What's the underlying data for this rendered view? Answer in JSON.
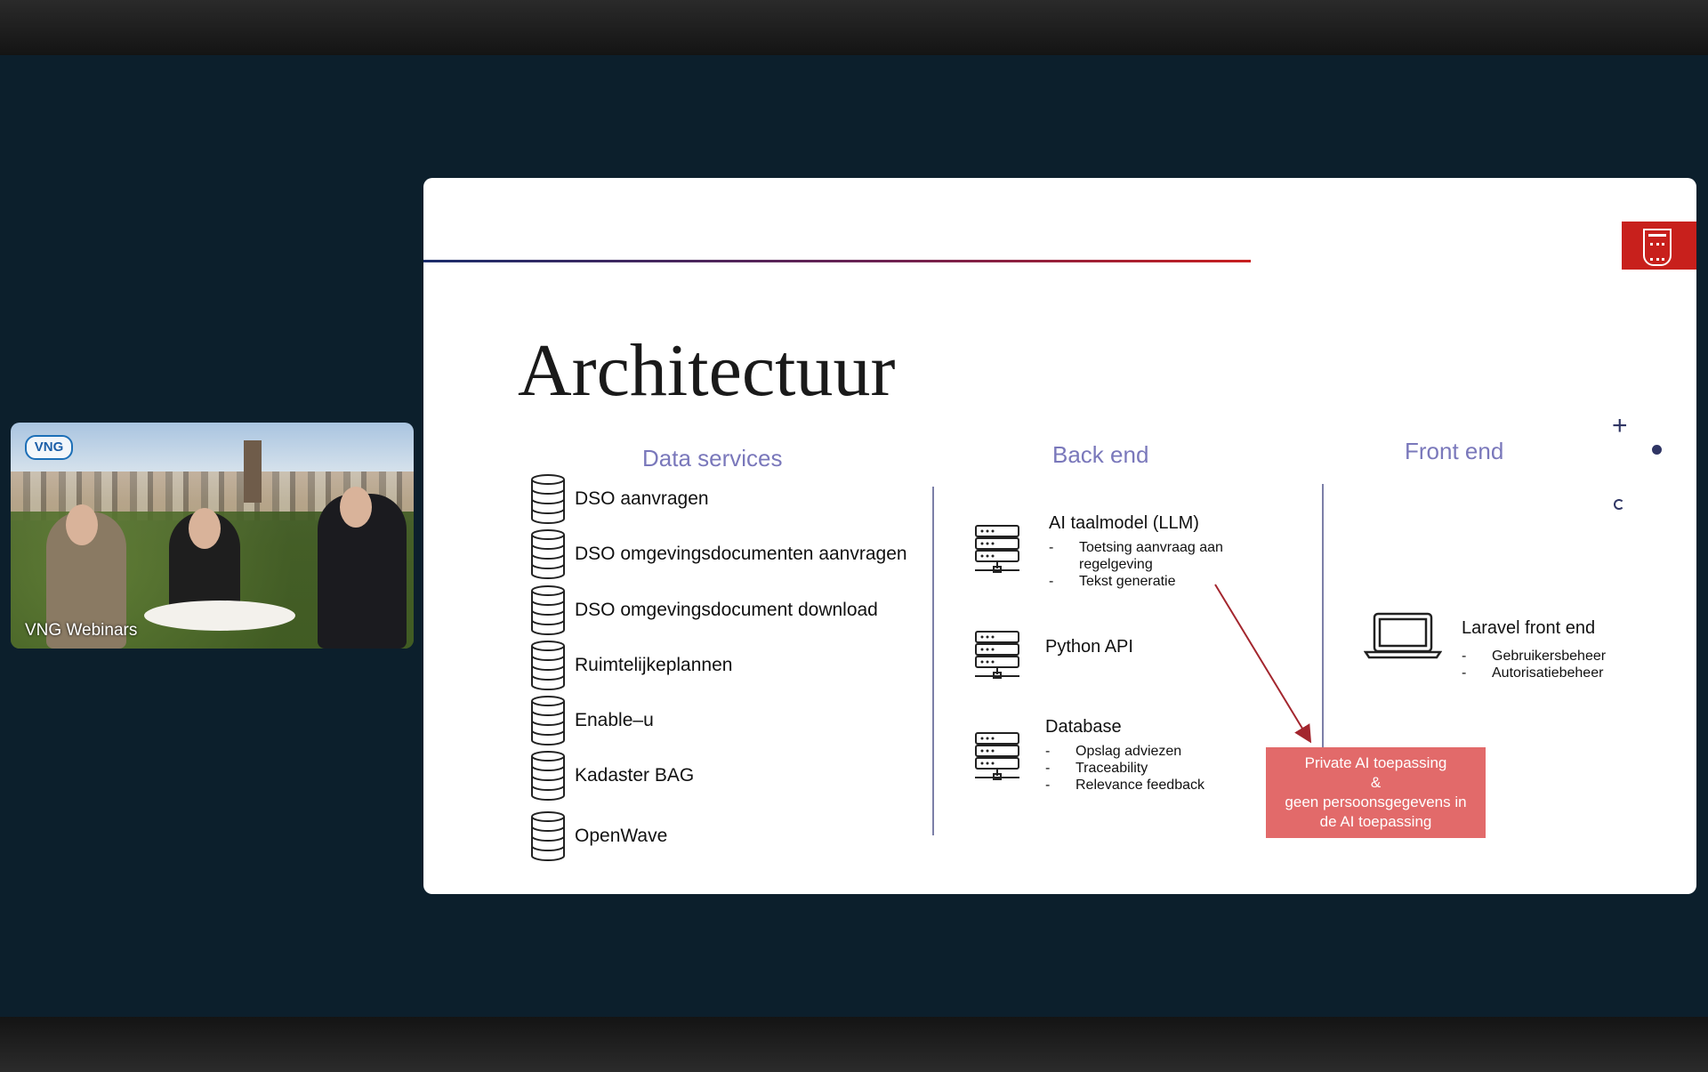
{
  "webcam": {
    "logo_text": "VNG",
    "caption": "VNG Webinars"
  },
  "slide": {
    "title": "Architectuur",
    "accent_colors": {
      "heading": "#7a78bb",
      "box": "#e26a6a",
      "crest": "#c8201c"
    },
    "data_services": {
      "heading": "Data services",
      "items": [
        "DSO aanvragen",
        "DSO omgevingsdocumenten aanvragen",
        "DSO omgevingsdocument download",
        "Ruimtelijkeplannen",
        "Enable–u",
        "Kadaster BAG",
        "OpenWave"
      ]
    },
    "back_end": {
      "heading": "Back end",
      "blocks": [
        {
          "label": "AI taalmodel (LLM)",
          "bullets": [
            "Toetsing aanvraag aan regelgeving",
            "Tekst generatie"
          ]
        },
        {
          "label": "Python API",
          "bullets": []
        },
        {
          "label": "Database",
          "bullets": [
            "Opslag adviezen",
            "Traceability",
            "Relevance feedback"
          ]
        }
      ]
    },
    "front_end": {
      "heading": "Front end",
      "label": "Laravel front end",
      "bullets": [
        "Gebruikersbeheer",
        "Autorisatiebeheer"
      ]
    },
    "callout": {
      "line1": "Private AI toepassing",
      "line2": "&",
      "line3": "geen persoonsgegevens in",
      "line4": "de AI toepassing"
    },
    "decor": {
      "plus": "+"
    }
  }
}
